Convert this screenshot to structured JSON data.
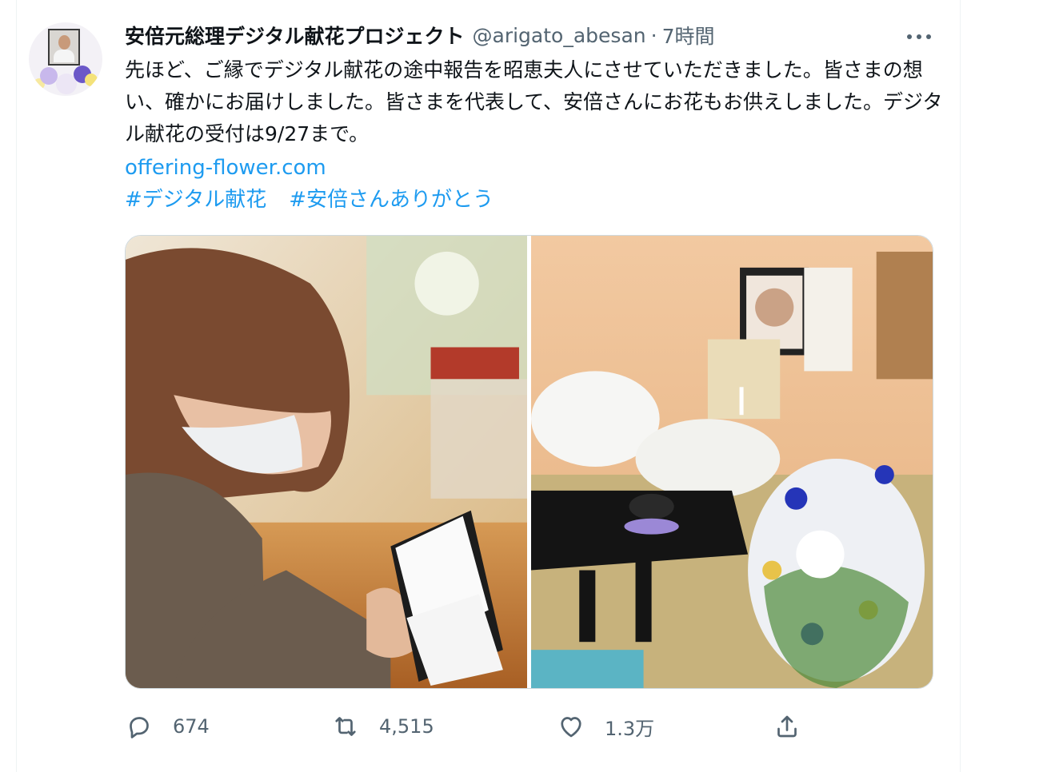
{
  "tweet": {
    "display_name": "安倍元総理デジタル献花プロジェクト",
    "handle": "@arigato_abesan",
    "separator": "·",
    "time": "7時間",
    "text": "先ほど、ご縁でデジタル献花の途中報告を昭恵夫人にさせていただきました。皆さまの想い、確かにお届けしました。皆さまを代表して、安倍さんにお花もお供えしました。デジタル献花の受付は9/27まで。",
    "link": "offering-flower.com",
    "hashtags": [
      "#デジタル献花",
      "#安倍さんありがとう"
    ],
    "media": [
      {
        "alt": "woman-reading-album-photo"
      },
      {
        "alt": "memorial-altar-with-flowers-photo"
      }
    ]
  },
  "actions": {
    "reply_count": "674",
    "retweet_count": "4,515",
    "like_count": "1.3万",
    "reply_icon": "reply-icon",
    "retweet_icon": "retweet-icon",
    "like_icon": "heart-icon",
    "share_icon": "share-icon"
  },
  "colors": {
    "link": "#1d9bf0",
    "secondary_text": "#536471",
    "primary_text": "#0f1419"
  }
}
